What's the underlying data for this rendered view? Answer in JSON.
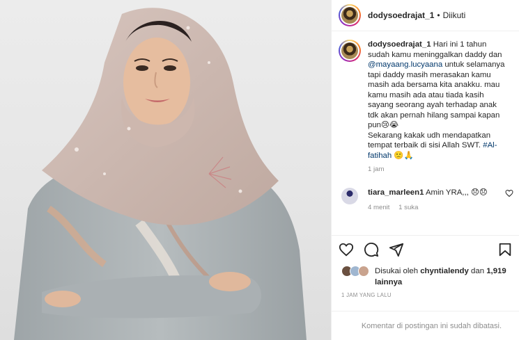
{
  "header": {
    "username": "dodysoedrajat_1",
    "separator": "•",
    "follow_status": "Diikuti"
  },
  "caption": {
    "username": "dodysoedrajat_1",
    "text_1": " Hari ini 1 tahun sudah kamu meninggalkan daddy dan ",
    "mention": "@mayaang.lucyaana",
    "text_2": " untuk selamanya tapi daddy masih merasakan kamu masih ada bersama kita anakku. mau kamu masih ada atau tiada kasih sayang seorang ayah terhadap anak tdk akan pernah hilang sampai kapan pun😢😭",
    "text_3": "Sekarang kakak udh mendapatkan tempat terbaik di sisi Allah SWT. ",
    "hashtag": "#Al-fatihah",
    "text_4": " 🙁🙏",
    "time": "1 jam"
  },
  "comment": {
    "username": "tiara_marleen1",
    "text": " Amin YRA,,, 😞😞",
    "time": "4 menit",
    "likes": "1 suka"
  },
  "likes": {
    "prefix": "Disukai oleh ",
    "liker": "chyntialendy",
    "mid": " dan ",
    "count": "1,919 lainnya"
  },
  "timestamp": "1 JAM YANG LALU",
  "comments_closed": "Komentar di postingan ini sudah dibatasi.",
  "icons": {
    "heart": "heart-icon",
    "comment": "comment-icon",
    "share": "share-icon",
    "save": "bookmark-icon"
  },
  "colors": {
    "text": "#262626",
    "muted": "#8e8e8e",
    "link": "#00376b",
    "border": "#efefef"
  }
}
